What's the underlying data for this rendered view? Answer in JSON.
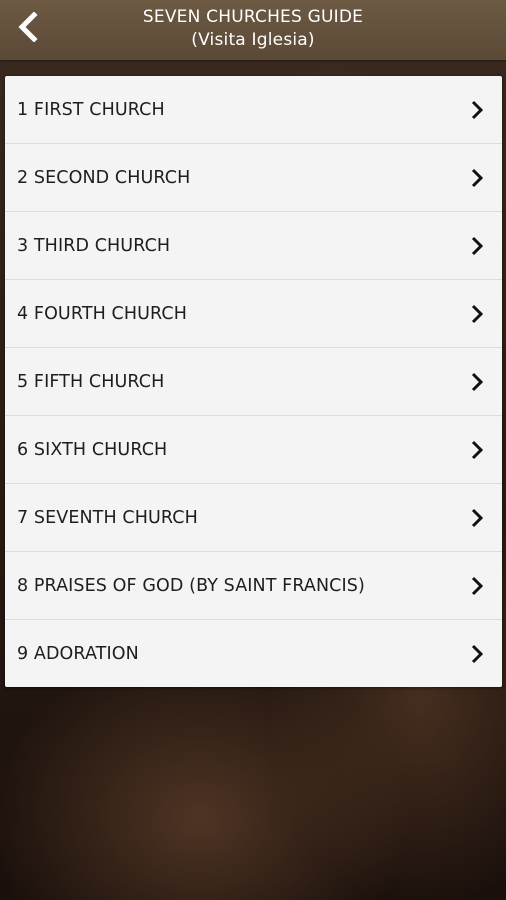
{
  "header": {
    "title": "SEVEN CHURCHES GUIDE",
    "subtitle": "(Visita Iglesia)",
    "back_icon": "chevron-left-icon"
  },
  "menu": {
    "items": [
      {
        "label": "1 FIRST CHURCH"
      },
      {
        "label": "2 SECOND CHURCH"
      },
      {
        "label": "3 THIRD CHURCH"
      },
      {
        "label": "4 FOURTH CHURCH"
      },
      {
        "label": "5 FIFTH CHURCH"
      },
      {
        "label": "6 SIXTH CHURCH"
      },
      {
        "label": "7 SEVENTH CHURCH"
      },
      {
        "label": "8 PRAISES OF GOD (BY SAINT FRANCIS)"
      },
      {
        "label": "9 ADORATION"
      }
    ],
    "item_icon": "chevron-right-icon"
  },
  "colors": {
    "header": "#5f4d3a",
    "list_background": "#f4f4f4",
    "text": "#1e1e1e"
  }
}
